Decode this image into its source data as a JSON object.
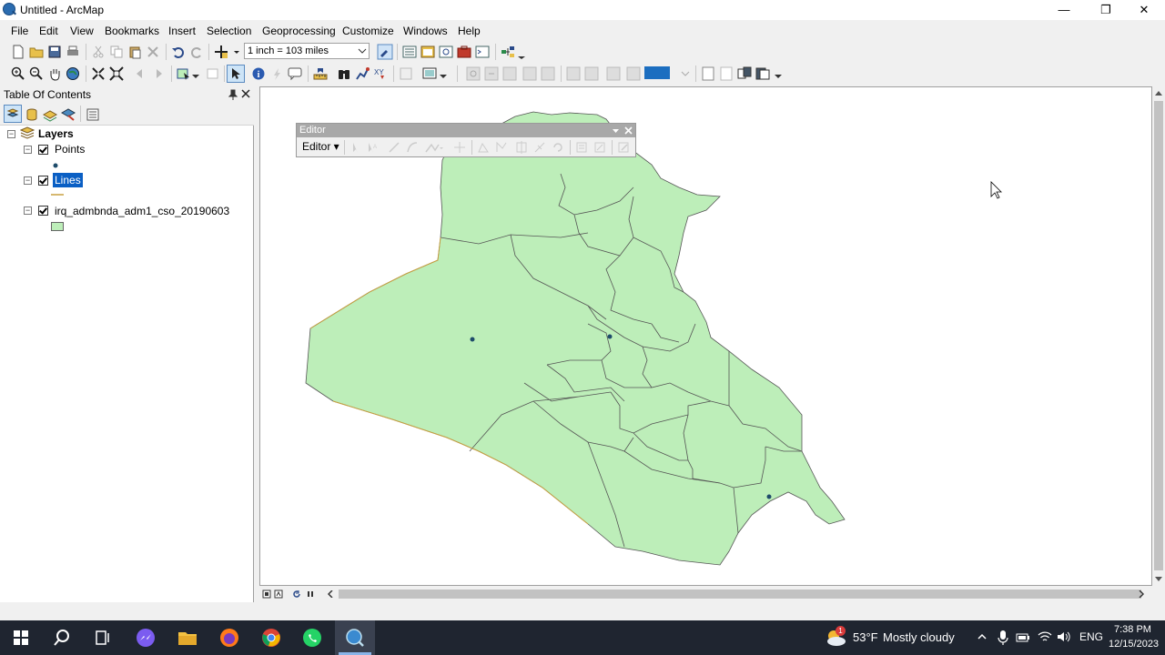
{
  "window": {
    "title": "Untitled - ArcMap",
    "minimize_glyph": "—",
    "restore_glyph": "❐",
    "close_glyph": "✕"
  },
  "menu": [
    "File",
    "Edit",
    "View",
    "Bookmarks",
    "Insert",
    "Selection",
    "Geoprocessing",
    "Customize",
    "Windows",
    "Help"
  ],
  "toolbar": {
    "scale": "1 inch = 103 miles"
  },
  "toc": {
    "title": "Table Of Contents",
    "root": "Layers",
    "layers": [
      {
        "name": "Points",
        "checked": true,
        "symbol": "point"
      },
      {
        "name": "Lines",
        "checked": true,
        "selected": true,
        "symbol": "line"
      },
      {
        "name": "irq_admbnda_adm1_cso_20190603",
        "checked": true,
        "symbol": "polygon"
      }
    ]
  },
  "editor": {
    "title": "Editor",
    "menu_label": "Editor ▾"
  },
  "map": {
    "fill_color": "#bdeeb9",
    "outline_color": "#555555",
    "points_color": "#1e4b6a"
  },
  "taskbar": {
    "weather_temp": "53°F",
    "weather_desc": "Mostly cloudy",
    "language": "ENG",
    "time": "7:38 PM",
    "date": "12/15/2023",
    "notification_count": "1"
  }
}
